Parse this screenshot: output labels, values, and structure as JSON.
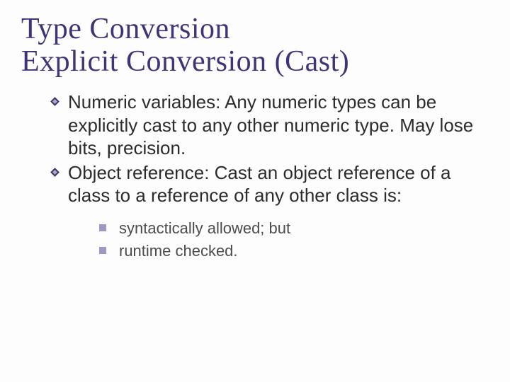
{
  "title_line1": "Type Conversion",
  "title_line2": "Explicit Conversion (Cast)",
  "body": {
    "items": [
      "Numeric variables: Any numeric types can be explicitly cast to any other numeric type. May lose bits, precision.",
      "Object reference: Cast an object reference of a class to a reference of any other class is:"
    ]
  },
  "sub": {
    "items": [
      "syntactically allowed; but",
      "runtime checked."
    ]
  },
  "colors": {
    "title": "#3e3576",
    "bullet_fill": "#8a80b8",
    "sub_bullet": "#a097c5"
  }
}
